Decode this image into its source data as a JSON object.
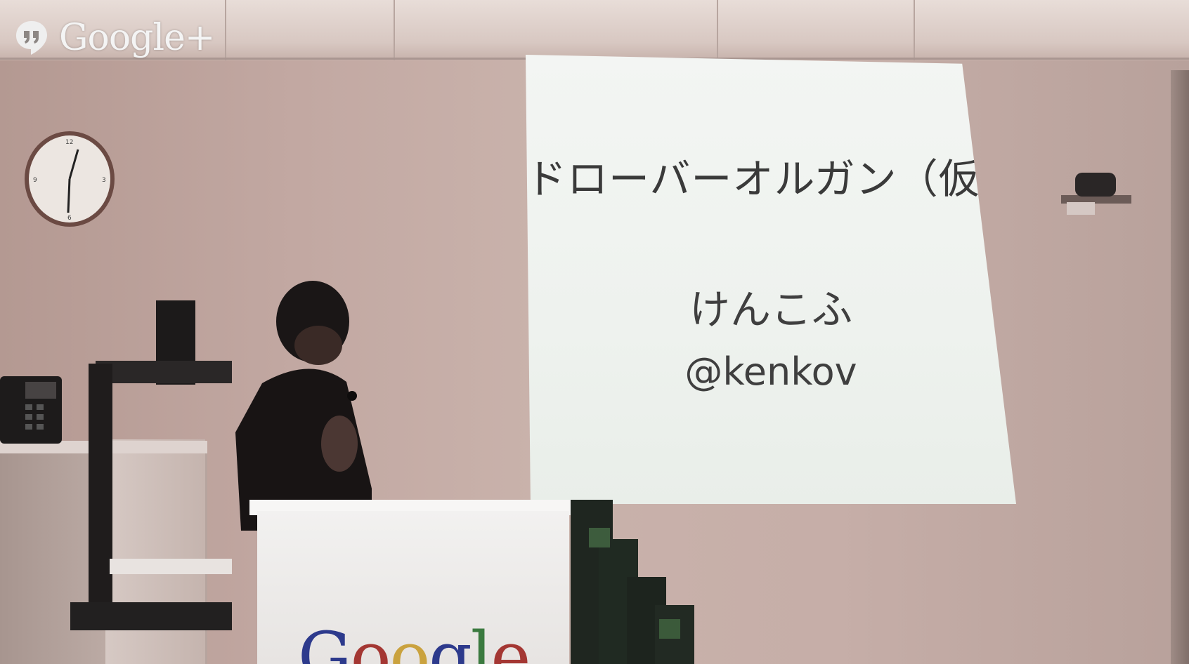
{
  "overlay": {
    "brand": "Google+",
    "icon": "hangouts-icon"
  },
  "slide": {
    "title": "ドローバーオルガン（仮）",
    "author": "けんこふ",
    "handle": "@kenkov"
  },
  "podium": {
    "brand_letters": [
      "G",
      "o",
      "o",
      "g",
      "l",
      "e"
    ]
  }
}
